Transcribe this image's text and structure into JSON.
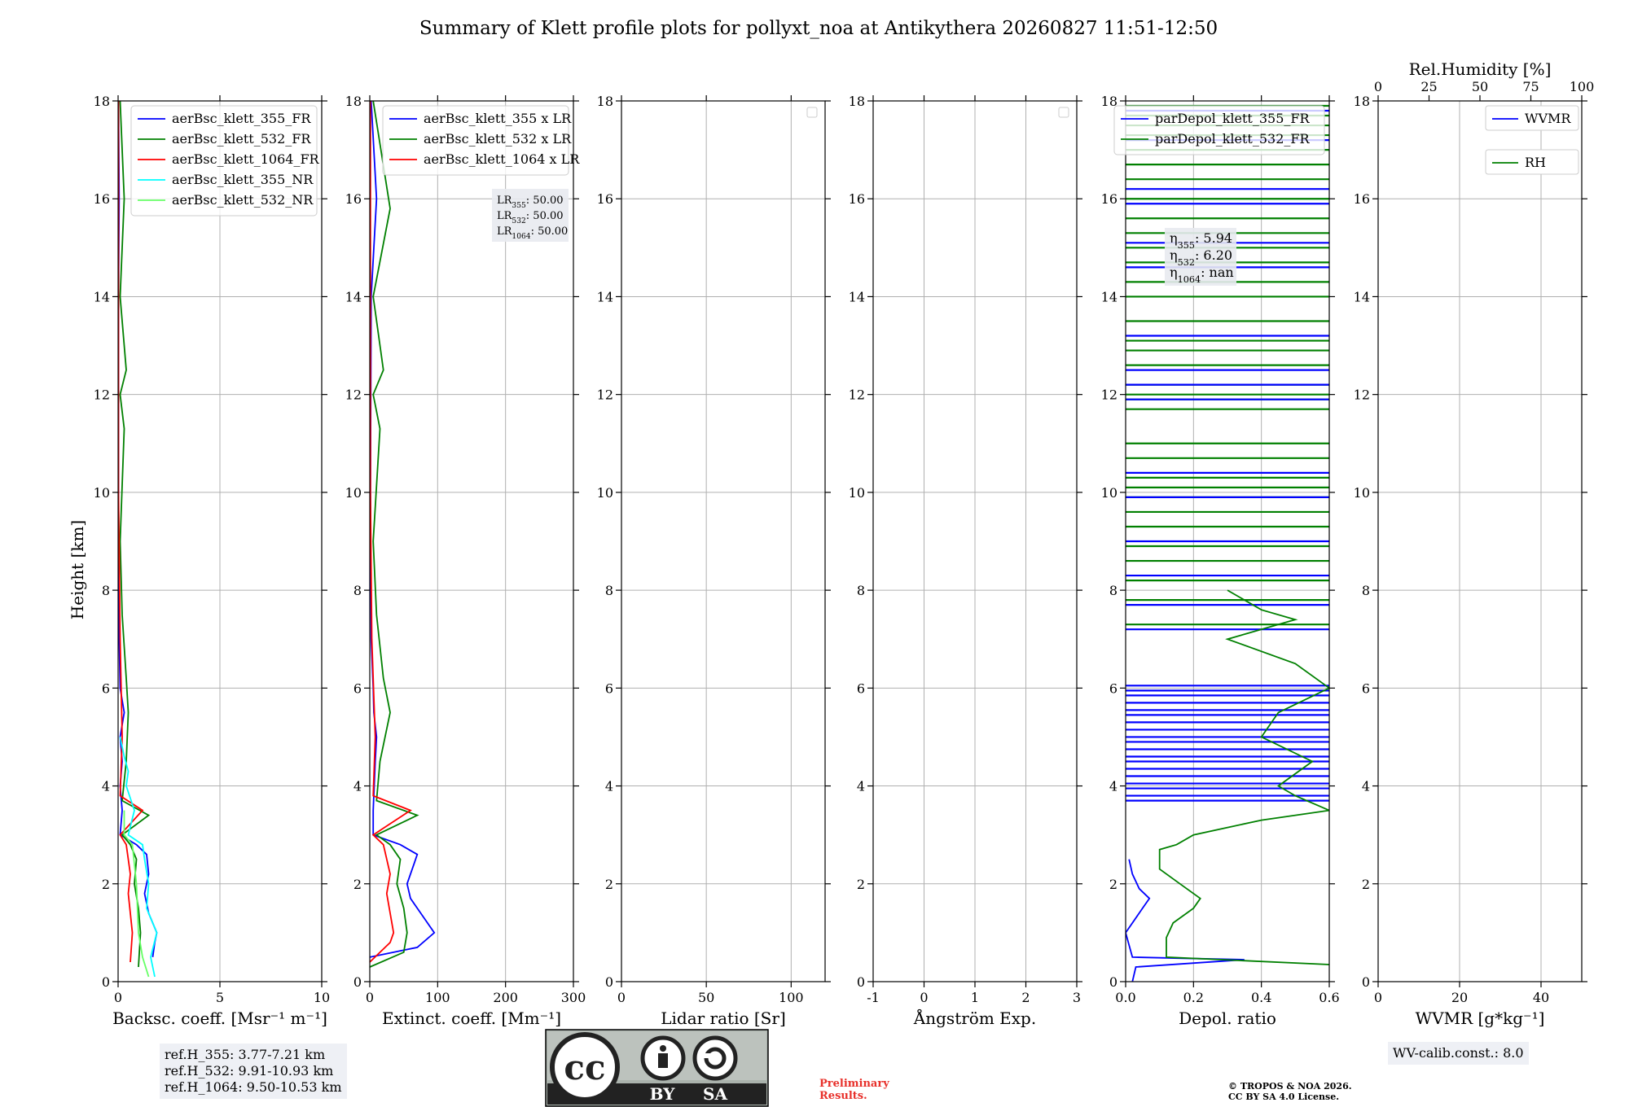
{
  "title": "Summary of Klett profile plots for pollyxt_noa at Antikythera 20260827 11:51-12:50",
  "colors": {
    "c355": "#0000ff",
    "c532": "#008000",
    "c1064": "#ff0000",
    "c355nr": "#00ffff",
    "c532nr": "#66ff66"
  },
  "chart_data": [
    {
      "type": "line",
      "id": "backscatter",
      "xlabel": "Backsc. coeff. [Msr⁻¹ m⁻¹]",
      "ylabel": "Height [km]",
      "xlim": [
        0,
        10
      ],
      "ylim": [
        0,
        18
      ],
      "xticks": [
        0,
        5,
        10
      ],
      "yticks": [
        0,
        2,
        4,
        6,
        8,
        10,
        12,
        14,
        16,
        18
      ],
      "grid": true,
      "legend_position": "top-right",
      "series": [
        {
          "name": "aerBsc_klett_355_FR",
          "color": "#0000ff",
          "points": [
            [
              1.7,
              0.5
            ],
            [
              1.8,
              0.8
            ],
            [
              1.9,
              1.0
            ],
            [
              1.5,
              1.4
            ],
            [
              1.3,
              1.8
            ],
            [
              1.5,
              2.2
            ],
            [
              1.4,
              2.6
            ],
            [
              0.9,
              2.8
            ],
            [
              0.1,
              3.0
            ],
            [
              0.2,
              3.5
            ],
            [
              0.1,
              4.0
            ],
            [
              0.2,
              4.5
            ],
            [
              0.1,
              5.0
            ],
            [
              0.3,
              5.5
            ],
            [
              0.1,
              6.0
            ],
            [
              0.05,
              7.0
            ],
            [
              0.02,
              10.0
            ],
            [
              0.02,
              14.0
            ],
            [
              0.05,
              16.0
            ],
            [
              0.02,
              18.0
            ]
          ]
        },
        {
          "name": "aerBsc_klett_532_FR",
          "color": "#008000",
          "points": [
            [
              1.0,
              0.3
            ],
            [
              1.1,
              1.0
            ],
            [
              1.0,
              1.5
            ],
            [
              0.8,
              2.0
            ],
            [
              0.9,
              2.5
            ],
            [
              0.6,
              2.8
            ],
            [
              0.2,
              3.0
            ],
            [
              1.5,
              3.4
            ],
            [
              0.2,
              3.7
            ],
            [
              0.4,
              4.5
            ],
            [
              0.5,
              5.5
            ],
            [
              0.4,
              6.2
            ],
            [
              0.2,
              7.5
            ],
            [
              0.1,
              9.0
            ],
            [
              0.3,
              11.3
            ],
            [
              0.1,
              12.0
            ],
            [
              0.4,
              12.5
            ],
            [
              0.1,
              14.0
            ],
            [
              0.3,
              16.0
            ],
            [
              0.1,
              18.0
            ]
          ]
        },
        {
          "name": "aerBsc_klett_1064_FR",
          "color": "#ff0000",
          "points": [
            [
              0.6,
              0.4
            ],
            [
              0.7,
              1.0
            ],
            [
              0.5,
              1.8
            ],
            [
              0.6,
              2.2
            ],
            [
              0.4,
              2.8
            ],
            [
              0.1,
              3.0
            ],
            [
              1.2,
              3.5
            ],
            [
              0.1,
              3.8
            ],
            [
              0.2,
              5.0
            ],
            [
              0.1,
              7.0
            ],
            [
              0.02,
              10.0
            ],
            [
              0.02,
              18.0
            ]
          ]
        },
        {
          "name": "aerBsc_klett_355_NR",
          "color": "#00ffff",
          "points": [
            [
              1.8,
              0.1
            ],
            [
              1.6,
              0.5
            ],
            [
              1.9,
              1.0
            ],
            [
              1.4,
              1.5
            ],
            [
              1.5,
              2.0
            ],
            [
              1.3,
              2.5
            ],
            [
              1.2,
              2.8
            ],
            [
              0.5,
              3.0
            ],
            [
              0.8,
              3.5
            ],
            [
              0.4,
              4.0
            ],
            [
              0.5,
              4.3
            ],
            [
              0.3,
              4.6
            ],
            [
              0.1,
              5.0
            ]
          ]
        },
        {
          "name": "aerBsc_klett_532_NR",
          "color": "#66ff66",
          "points": [
            [
              1.5,
              0.1
            ],
            [
              1.2,
              0.5
            ],
            [
              1.0,
              1.0
            ],
            [
              0.9,
              2.0
            ],
            [
              0.7,
              2.8
            ],
            [
              0.3,
              3.0
            ],
            [
              0.3,
              3.5
            ]
          ]
        }
      ],
      "annotation_lines": []
    },
    {
      "type": "line",
      "id": "extinction",
      "xlabel": "Extinct. coeff. [Mm⁻¹]",
      "xlim": [
        0,
        300
      ],
      "ylim": [
        0,
        18
      ],
      "xticks": [
        0,
        100,
        200,
        300
      ],
      "yticks": [
        0,
        2,
        4,
        6,
        8,
        10,
        12,
        14,
        16,
        18
      ],
      "grid": true,
      "legend_position": "top-right",
      "series": [
        {
          "name": "aerBsc_klett_355 x LR",
          "color": "#0000ff",
          "points": [
            [
              0,
              0.5
            ],
            [
              70,
              0.7
            ],
            [
              95,
              1.0
            ],
            [
              80,
              1.3
            ],
            [
              60,
              1.7
            ],
            [
              55,
              2.0
            ],
            [
              65,
              2.4
            ],
            [
              70,
              2.6
            ],
            [
              45,
              2.8
            ],
            [
              5,
              3.0
            ],
            [
              5,
              3.5
            ],
            [
              8,
              4.5
            ],
            [
              10,
              5.0
            ],
            [
              6,
              5.5
            ],
            [
              5,
              6.0
            ],
            [
              2,
              7.0
            ],
            [
              1,
              10.0
            ],
            [
              2,
              14.0
            ],
            [
              10,
              16.0
            ],
            [
              2,
              18.0
            ]
          ]
        },
        {
          "name": "aerBsc_klett_532 x LR",
          "color": "#008000",
          "points": [
            [
              0,
              0.3
            ],
            [
              50,
              0.6
            ],
            [
              55,
              1.0
            ],
            [
              50,
              1.5
            ],
            [
              40,
              2.0
            ],
            [
              45,
              2.5
            ],
            [
              30,
              2.8
            ],
            [
              10,
              3.0
            ],
            [
              70,
              3.4
            ],
            [
              10,
              3.7
            ],
            [
              15,
              4.5
            ],
            [
              30,
              5.5
            ],
            [
              20,
              6.2
            ],
            [
              10,
              7.5
            ],
            [
              5,
              9.0
            ],
            [
              15,
              11.3
            ],
            [
              5,
              12.0
            ],
            [
              20,
              12.5
            ],
            [
              5,
              14.0
            ],
            [
              30,
              15.8
            ],
            [
              5,
              18.0
            ]
          ]
        },
        {
          "name": "aerBsc_klett_1064 x LR",
          "color": "#ff0000",
          "points": [
            [
              0,
              0.4
            ],
            [
              30,
              0.8
            ],
            [
              35,
              1.0
            ],
            [
              25,
              1.8
            ],
            [
              30,
              2.2
            ],
            [
              20,
              2.8
            ],
            [
              5,
              3.0
            ],
            [
              60,
              3.5
            ],
            [
              5,
              3.8
            ],
            [
              8,
              5.0
            ],
            [
              3,
              7.0
            ],
            [
              1,
              10.0
            ],
            [
              1,
              18.0
            ]
          ]
        }
      ],
      "info_text": [
        "LR355: 50.00",
        "LR532: 50.00",
        "LR1064: 50.00"
      ]
    },
    {
      "type": "line",
      "id": "lidar_ratio",
      "xlabel": "Lidar ratio [Sr]",
      "xlim": [
        0,
        120
      ],
      "ylim": [
        0,
        18
      ],
      "xticks": [
        0,
        50,
        100
      ],
      "yticks": [
        0,
        2,
        4,
        6,
        8,
        10,
        12,
        14,
        16,
        18
      ],
      "grid": true,
      "series": []
    },
    {
      "type": "line",
      "id": "angstrom",
      "xlabel": "Ångström Exp.",
      "xlim": [
        -1,
        3
      ],
      "ylim": [
        0,
        18
      ],
      "xticks": [
        -1,
        0,
        1,
        2,
        3
      ],
      "yticks": [
        0,
        2,
        4,
        6,
        8,
        10,
        12,
        14,
        16,
        18
      ],
      "grid": true,
      "series": []
    },
    {
      "type": "line",
      "id": "depol",
      "xlabel": "Depol. ratio",
      "xlim": [
        0,
        0.6
      ],
      "ylim": [
        0,
        18
      ],
      "xticks": [
        0.0,
        0.2,
        0.4,
        0.6
      ],
      "yticks": [
        0,
        2,
        4,
        6,
        8,
        10,
        12,
        14,
        16,
        18
      ],
      "grid": true,
      "legend_position": "top-right",
      "series": [
        {
          "name": "parDepol_klett_355_FR",
          "color": "#0000ff",
          "points": [
            [
              0.02,
              0.0
            ],
            [
              0.03,
              0.3
            ],
            [
              0.35,
              0.45
            ],
            [
              0.02,
              0.5
            ],
            [
              0.0,
              1.0
            ],
            [
              0.05,
              1.5
            ],
            [
              0.07,
              1.7
            ],
            [
              0.04,
              1.9
            ],
            [
              0.02,
              2.2
            ],
            [
              0.01,
              2.5
            ]
          ]
        },
        {
          "name": "parDepol_klett_532_FR",
          "color": "#008000",
          "points": [
            [
              0.6,
              0.35
            ],
            [
              0.12,
              0.5
            ],
            [
              0.12,
              0.9
            ],
            [
              0.14,
              1.2
            ],
            [
              0.2,
              1.5
            ],
            [
              0.22,
              1.7
            ],
            [
              0.16,
              2.0
            ],
            [
              0.1,
              2.3
            ],
            [
              0.1,
              2.7
            ],
            [
              0.15,
              2.8
            ],
            [
              0.2,
              3.0
            ],
            [
              0.4,
              3.3
            ],
            [
              0.6,
              3.5
            ],
            [
              0.5,
              3.8
            ],
            [
              0.45,
              4.0
            ],
            [
              0.55,
              4.5
            ],
            [
              0.4,
              5.0
            ],
            [
              0.45,
              5.5
            ],
            [
              0.6,
              6.0
            ],
            [
              0.5,
              6.5
            ],
            [
              0.3,
              7.0
            ],
            [
              0.5,
              7.4
            ],
            [
              0.4,
              7.6
            ],
            [
              0.3,
              8.0
            ]
          ]
        }
      ],
      "stripe_levels_355": [
        3.7,
        3.8,
        3.95,
        4.05,
        4.2,
        4.35,
        4.5,
        4.6,
        4.75,
        4.9,
        5.0,
        5.15,
        5.3,
        5.45,
        5.55,
        5.7,
        5.85,
        5.95,
        6.05,
        7.2,
        7.7,
        8.3,
        9.0,
        9.9,
        10.4,
        11.9,
        12.2,
        12.5,
        13.2,
        14.6,
        15.1,
        15.9,
        16.2,
        17.2,
        17.8
      ],
      "stripe_levels_532": [
        7.3,
        7.8,
        8.2,
        8.6,
        8.9,
        9.3,
        9.6,
        9.9,
        10.1,
        10.3,
        10.7,
        11.0,
        11.7,
        11.9,
        12.0,
        12.2,
        12.6,
        12.9,
        13.1,
        13.5,
        14.0,
        14.3,
        14.7,
        15.0,
        15.3,
        15.6,
        16.0,
        16.4,
        16.7,
        17.0,
        17.3,
        17.5,
        17.7,
        17.9
      ],
      "info_text": [
        "η355: 5.94",
        "η532: 6.20",
        "η1064: nan"
      ]
    },
    {
      "type": "line",
      "id": "wvmr",
      "xlabel": "WVMR [g*kg⁻¹]",
      "top_xlabel": "Rel.Humidity [%]",
      "xlim": [
        0,
        50
      ],
      "ylim": [
        0,
        18
      ],
      "xticks": [
        0,
        20,
        40
      ],
      "top_xticks": [
        0,
        25,
        50,
        75,
        100
      ],
      "yticks": [
        0,
        2,
        4,
        6,
        8,
        10,
        12,
        14,
        16,
        18
      ],
      "grid": true,
      "legend_position": "top-right",
      "series": [
        {
          "name": "WVMR",
          "color": "#0000ff",
          "points": []
        },
        {
          "name": "RH",
          "color": "#008000",
          "points": []
        }
      ]
    }
  ],
  "footer": {
    "ref_heights": [
      "ref.H_355: 3.77-7.21 km",
      "ref.H_532: 9.91-10.93 km",
      "ref.H_1064: 9.50-10.53 km"
    ],
    "license_badge": {
      "cc": "cc",
      "by": "BY",
      "sa": "SA"
    },
    "preliminary": [
      "Preliminary",
      "Results."
    ],
    "copyright": [
      "© TROPOS & NOA 2026.",
      "CC BY SA 4.0 License."
    ],
    "wv_calib": "WV-calib.const.: 8.0"
  }
}
